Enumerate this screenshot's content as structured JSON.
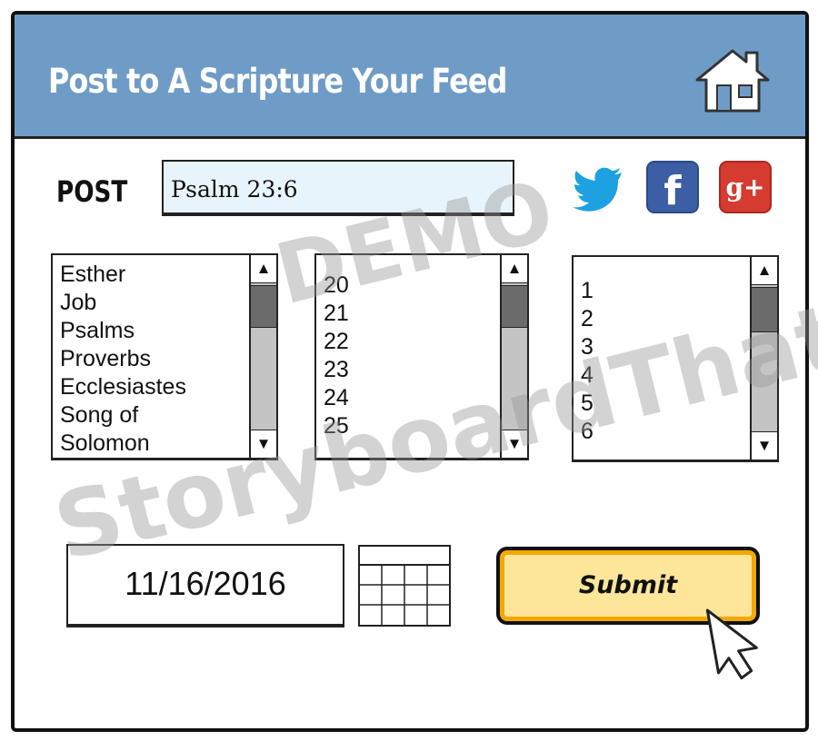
{
  "header": {
    "title": "Post to A Scripture Your Feed",
    "icon": "home-icon",
    "color": "#6f9cc7"
  },
  "post": {
    "label": "POST",
    "value": "Psalm 23:6",
    "social_icons": [
      "twitter-icon",
      "facebook-icon",
      "google-plus-icon"
    ],
    "google_plus_glyph": "g+",
    "facebook_glyph": "f"
  },
  "books": {
    "items": [
      "Esther",
      "Job",
      "Psalms",
      "Proverbs",
      "Ecclesiastes",
      "Song of",
      "Solomon"
    ],
    "scroll_up": "▲",
    "scroll_down": "▼"
  },
  "chapters": {
    "items": [
      "20",
      "21",
      "22",
      "23",
      "24",
      "25"
    ],
    "scroll_up": "▲",
    "scroll_down": "▼"
  },
  "verses": {
    "items": [
      "1",
      "2",
      "3",
      "4",
      "5",
      "6"
    ],
    "scroll_up": "▲",
    "scroll_down": "▼"
  },
  "date": {
    "value": "11/16/2016",
    "icon": "calendar-icon"
  },
  "submit": {
    "label": "Submit",
    "fill": "#fde59a",
    "border": "#f5a800"
  },
  "watermark": {
    "line1": "DEMO",
    "line2": "StoryboardThat.com"
  }
}
